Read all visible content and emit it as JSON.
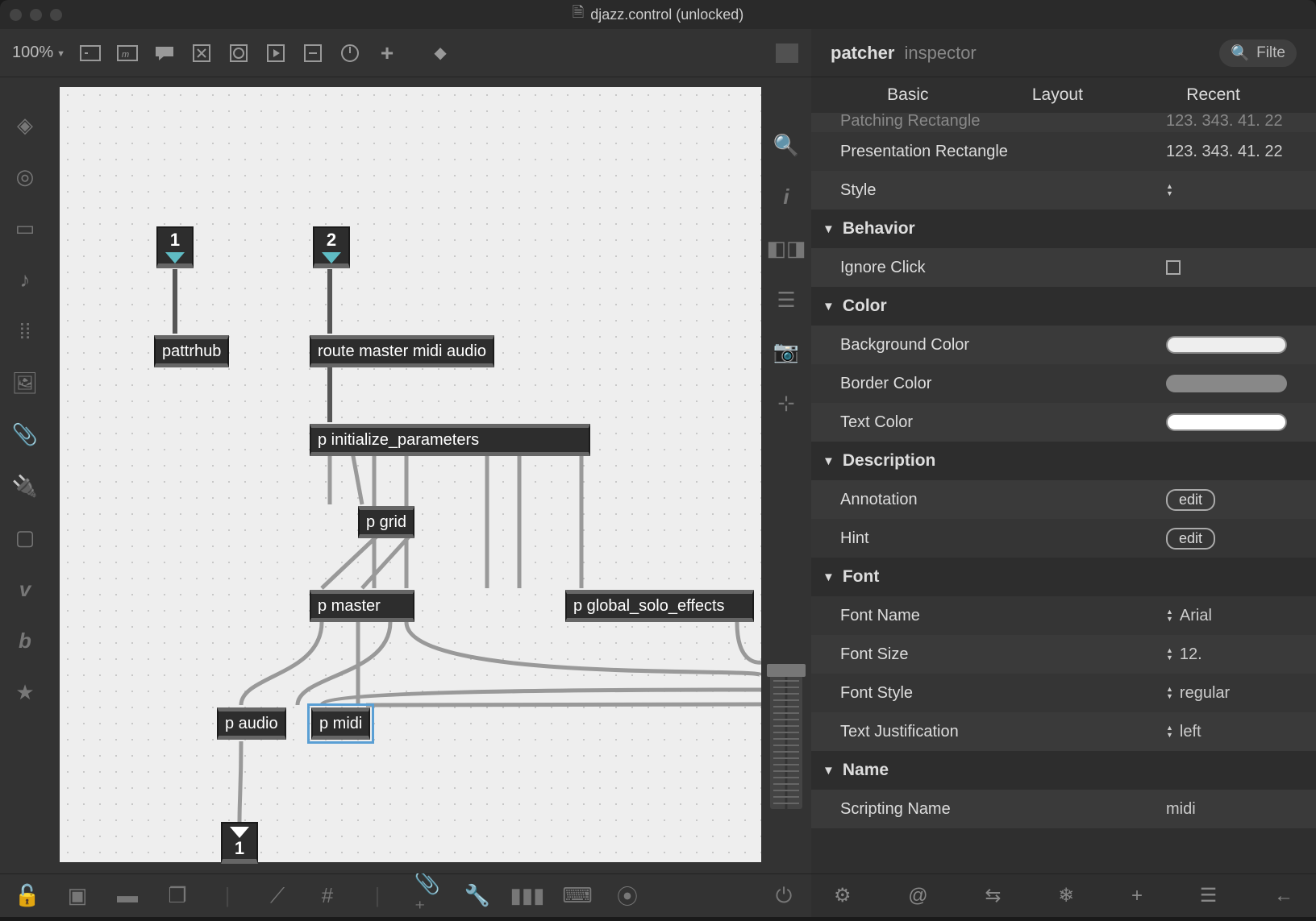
{
  "window": {
    "title": "djazz.control (unlocked)"
  },
  "toolbar": {
    "zoom": "100%"
  },
  "patch": {
    "inlets": [
      "1",
      "2"
    ],
    "outlets": [
      "1"
    ],
    "objects": {
      "pattrhub": "pattrhub",
      "route": "route master midi audio",
      "init": "p initialize_parameters",
      "grid": "p grid",
      "master": "p master",
      "solo": "p global_solo_effects",
      "audio": "p audio",
      "midi": "p midi"
    }
  },
  "inspector": {
    "title": "patcher",
    "subtitle": "inspector",
    "filter_placeholder": "Filte",
    "tabs": [
      "Basic",
      "Layout",
      "Recent"
    ],
    "sections": {
      "top": {
        "patching_rect_label": "Patching Rectangle",
        "patching_rect_value": "123. 343. 41. 22",
        "presentation_rect_label": "Presentation Rectangle",
        "presentation_rect_value": "123. 343. 41. 22",
        "style_label": "Style"
      },
      "behavior": {
        "title": "Behavior",
        "ignore_click": "Ignore Click"
      },
      "color": {
        "title": "Color",
        "bg": "Background Color",
        "border": "Border Color",
        "text": "Text Color"
      },
      "description": {
        "title": "Description",
        "annotation": "Annotation",
        "hint": "Hint",
        "edit": "edit"
      },
      "font": {
        "title": "Font",
        "name": "Font Name",
        "name_val": "Arial",
        "size": "Font Size",
        "size_val": "12.",
        "style": "Font Style",
        "style_val": "regular",
        "just": "Text Justification",
        "just_val": "left"
      },
      "name": {
        "title": "Name",
        "scripting": "Scripting Name",
        "scripting_val": "midi"
      }
    }
  }
}
